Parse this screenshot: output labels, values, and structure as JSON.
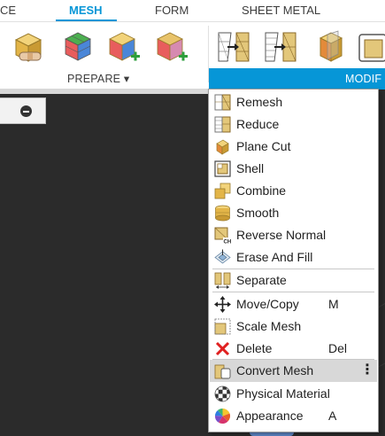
{
  "tabs": [
    {
      "label": "CE",
      "active": false
    },
    {
      "label": "MESH",
      "active": true
    },
    {
      "label": "FORM",
      "active": false
    },
    {
      "label": "SHEET METAL",
      "active": false
    }
  ],
  "ribbon": {
    "prepare_label": "PREPARE ▾",
    "modify_label": "MODIF"
  },
  "colors": {
    "accent": "#0696d7",
    "canvas": "#2b2b2b",
    "menu_highlight": "#d8d8d8"
  },
  "menu": {
    "items": [
      {
        "label": "Remesh",
        "icon": "remesh-icon",
        "shortcut": ""
      },
      {
        "label": "Reduce",
        "icon": "reduce-icon",
        "shortcut": ""
      },
      {
        "label": "Plane Cut",
        "icon": "plane-cut-icon",
        "shortcut": ""
      },
      {
        "label": "Shell",
        "icon": "shell-icon",
        "shortcut": ""
      },
      {
        "label": "Combine",
        "icon": "combine-icon",
        "shortcut": ""
      },
      {
        "label": "Smooth",
        "icon": "smooth-icon",
        "shortcut": ""
      },
      {
        "label": "Reverse Normal",
        "icon": "reverse-normal-icon",
        "shortcut": ""
      },
      {
        "label": "Erase And Fill",
        "icon": "erase-and-fill-icon",
        "shortcut": ""
      },
      {
        "label": "Separate",
        "icon": "separate-icon",
        "shortcut": ""
      },
      {
        "label": "Move/Copy",
        "icon": "move-copy-icon",
        "shortcut": "M"
      },
      {
        "label": "Scale Mesh",
        "icon": "scale-mesh-icon",
        "shortcut": ""
      },
      {
        "label": "Delete",
        "icon": "delete-icon",
        "shortcut": "Del"
      },
      {
        "label": "Convert Mesh",
        "icon": "convert-mesh-icon",
        "shortcut": "",
        "highlighted": true,
        "more": "⋮"
      },
      {
        "label": "Physical Material",
        "icon": "physical-material-icon",
        "shortcut": ""
      },
      {
        "label": "Appearance",
        "icon": "appearance-icon",
        "shortcut": "A"
      }
    ]
  }
}
